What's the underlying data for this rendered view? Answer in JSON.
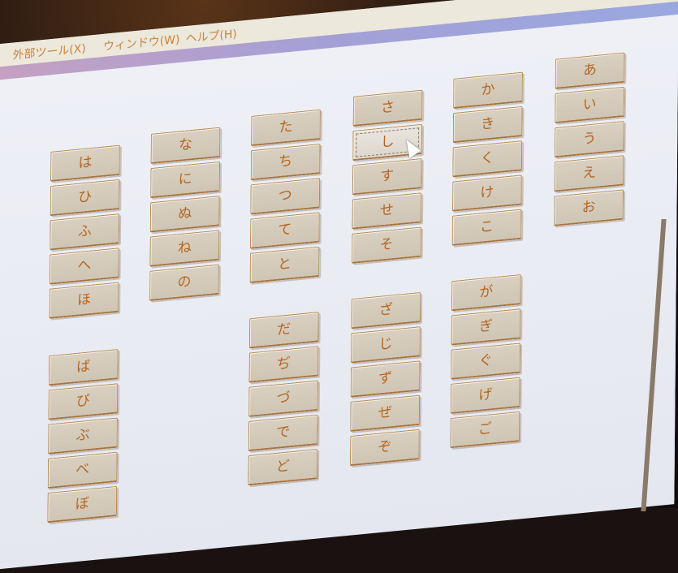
{
  "menu": [
    "外部ツール(X)",
    "ウィンドウ(W)",
    "ヘルプ(H)"
  ],
  "rows_top": [
    [
      "あ",
      "い",
      "う",
      "え",
      "お"
    ],
    [
      "か",
      "き",
      "く",
      "け",
      "こ"
    ],
    [
      "さ",
      "し",
      "す",
      "せ",
      "そ"
    ],
    [
      "た",
      "ち",
      "つ",
      "て",
      "と"
    ],
    [
      "な",
      "に",
      "ぬ",
      "ね",
      "の"
    ],
    [
      "は",
      "ひ",
      "ふ",
      "へ",
      "ほ"
    ]
  ],
  "rows_bottom": [
    [
      "が",
      "ぎ",
      "ぐ",
      "げ",
      "ご"
    ],
    [
      "ざ",
      "じ",
      "ず",
      "ぜ",
      "ぞ"
    ],
    [
      "だ",
      "ぢ",
      "づ",
      "で",
      "ど"
    ],
    [
      "ば",
      "び",
      "ぶ",
      "べ",
      "ぼ"
    ]
  ],
  "selected_key": "し",
  "colors": {
    "key_text": "#b5651f",
    "key_face": "#d4cab9",
    "screen": "#e8eaf3"
  }
}
